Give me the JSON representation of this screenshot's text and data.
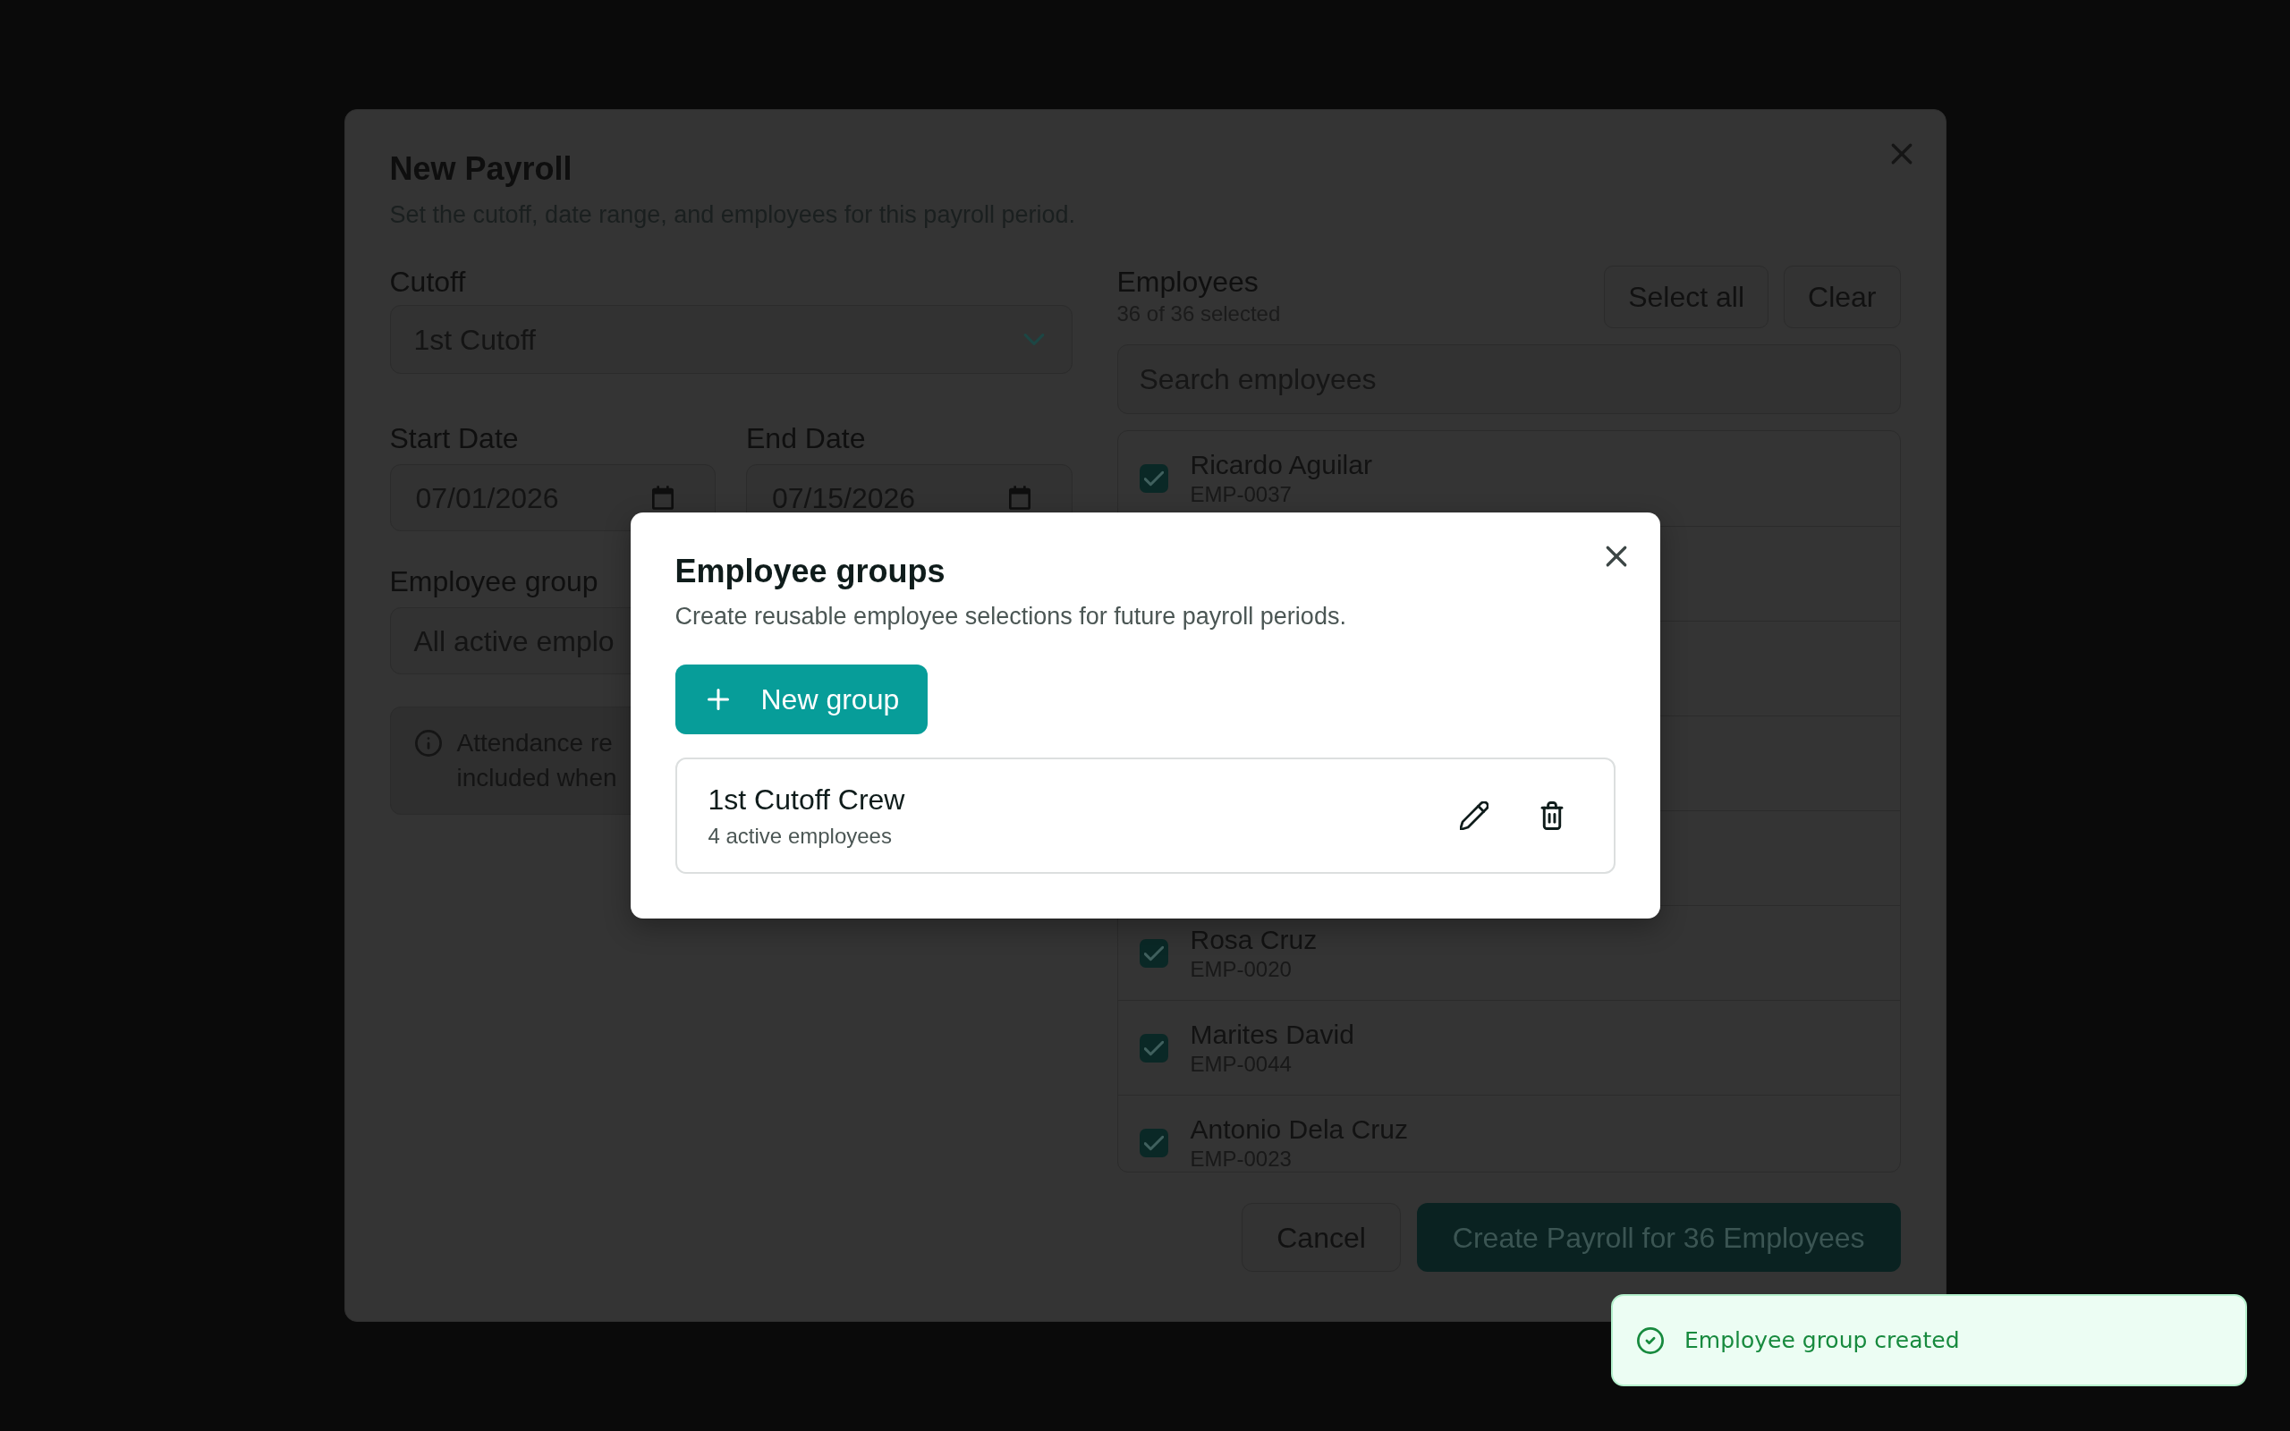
{
  "payroll_dialog": {
    "title": "New Payroll",
    "description": "Set the cutoff, date range, and employees for this payroll period.",
    "cutoff": {
      "label": "Cutoff",
      "value": "1st Cutoff"
    },
    "start_date": {
      "label": "Start Date",
      "value": "07/01/2026"
    },
    "end_date": {
      "label": "End Date",
      "value": "07/15/2026"
    },
    "employee_group": {
      "label": "Employee group",
      "value": "All active emplo"
    },
    "notice": {
      "lines": [
        "Attendance re",
        "included when"
      ]
    },
    "employees": {
      "title": "Employees",
      "summary": "36 of 36 selected",
      "actions": [
        "Select all",
        "Clear"
      ],
      "search": {
        "placeholder": "Search employees"
      },
      "rows_top": [
        {
          "name": "Ricardo Aguilar",
          "code": "EMP-0037",
          "checked": true
        }
      ],
      "rows_bottom": [
        {
          "name": "Rosa Cruz",
          "code": "EMP-0020",
          "checked": true
        },
        {
          "name": "Marites David",
          "code": "EMP-0044",
          "checked": true
        },
        {
          "name": "Antonio Dela Cruz",
          "code": "EMP-0023",
          "checked": true
        }
      ]
    },
    "buttons": [
      {
        "label": "Cancel",
        "kind": "secondary"
      },
      {
        "label": "Create Payroll for 36 Employees",
        "kind": "primary"
      }
    ]
  },
  "groups_dialog": {
    "title": "Employee groups",
    "description": "Create reusable employee selections for future payroll periods.",
    "new_button": "New group",
    "groups": [
      {
        "name": "1st Cutoff Crew",
        "count": "4 active employees"
      }
    ]
  },
  "toast": {
    "message": "Employee group created"
  }
}
